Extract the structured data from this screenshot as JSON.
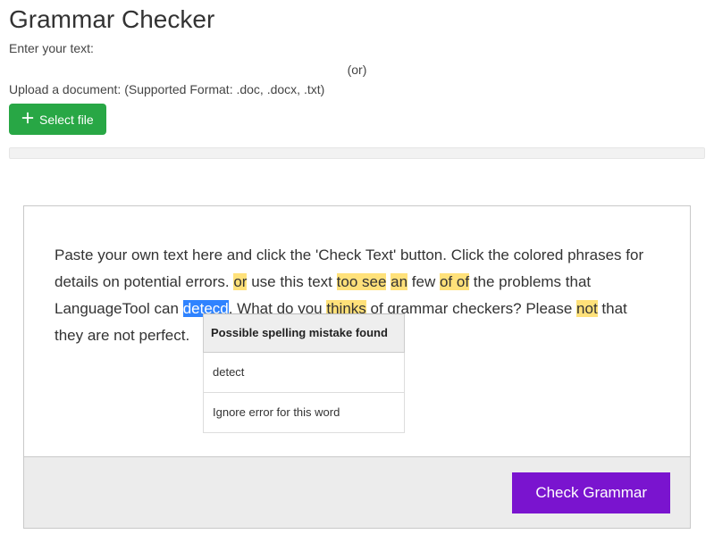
{
  "title": "Grammar Checker",
  "enter_label": "Enter your text:",
  "or_label": "(or)",
  "upload_label": "Upload a document: (Supported Format: .doc, .docx, .txt)",
  "select_file_label": "Select file",
  "editor": {
    "segments": [
      {
        "t": "Paste your own text here and click the 'Check Text' button. Click the colored phrases for details on potential errors. ",
        "hl": ""
      },
      {
        "t": "or",
        "hl": "yellow"
      },
      {
        "t": " use this text ",
        "hl": ""
      },
      {
        "t": "too see",
        "hl": "yellow"
      },
      {
        "t": " ",
        "hl": ""
      },
      {
        "t": "an",
        "hl": "yellow"
      },
      {
        "t": " few ",
        "hl": ""
      },
      {
        "t": "of of",
        "hl": "yellow"
      },
      {
        "t": " the problems that LanguageTool can ",
        "hl": ""
      },
      {
        "t": "detecd",
        "hl": "blue"
      },
      {
        "t": ". What do you ",
        "hl": ""
      },
      {
        "t": "thinks",
        "hl": "yellow"
      },
      {
        "t": " of grammar checkers? Please ",
        "hl": ""
      },
      {
        "t": "not",
        "hl": "yellow"
      },
      {
        "t": " that they are not perfect.",
        "hl": ""
      }
    ]
  },
  "popup": {
    "title": "Possible spelling mistake found",
    "suggestion": "detect",
    "ignore": "Ignore error for this word"
  },
  "check_button": "Check Grammar",
  "colors": {
    "green": "#28a745",
    "purple": "#7a14cf",
    "hl_yellow": "#ffe17a",
    "hl_blue": "#2f83ff"
  }
}
